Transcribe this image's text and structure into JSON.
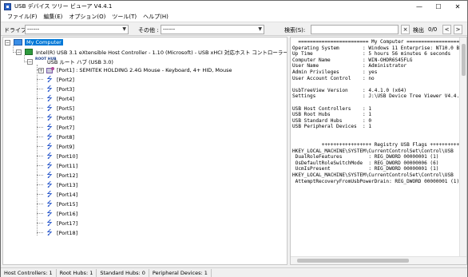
{
  "window": {
    "title": "USB デバイス ツリー ビューア V4.4.1",
    "minimize": "—",
    "maximize": "☐",
    "close": "✕"
  },
  "menu": [
    {
      "label": "ファイル(F)"
    },
    {
      "label": "編集(E)"
    },
    {
      "label": "オプション(O)"
    },
    {
      "label": "ツール(T)"
    },
    {
      "label": "ヘルプ(H)"
    }
  ],
  "toolbar": {
    "drive_label": "ドライブ:",
    "drive_value": "------",
    "other_label": "その他 :",
    "other_value": "------",
    "search_label": "検索(S):",
    "search_value": "",
    "clear_glyph": "×",
    "detect_label": "検出",
    "counter": "0/0",
    "prev_glyph": "<",
    "next_glyph": ">"
  },
  "tree": {
    "root": "My Computer",
    "controller": "Intel(R) USB 3.1 eXtensible Host Controller - 1.10 (Microsoft) - USB xHCI 対応ホスト コントローラー",
    "hub": "USB ルート ハブ (USB 3.0)",
    "hub_icon_text": "ROOT\nHUB",
    "device": "[Port1] : SEMITEK HOLDING 2.4G Mouse - Keyboard, 4+ HID, Mouse",
    "ports": [
      "[Port2]",
      "[Port3]",
      "[Port4]",
      "[Port5]",
      "[Port6]",
      "[Port7]",
      "[Port8]",
      "[Port9]",
      "[Port10]",
      "[Port11]",
      "[Port12]",
      "[Port13]",
      "[Port14]",
      "[Port15]",
      "[Port16]",
      "[Port17]",
      "[Port18]"
    ],
    "expanded_glyph": "−",
    "collapsed_glyph": "+",
    "usb_glyph": "⭍"
  },
  "info": {
    "text": "  ======================== My Computer =========================\nOperating System        : Windows 11 Enterprise: NT10.0 Bu\nUp Time                 : 5 hours 56 minutes 6 seconds\nComputer Name           : WIN-OHDR6S45FLG\nUser Name               : Administrator\nAdmin Privileges        : yes\nUser Account Control    : no\n\nUsbTreeView Version     : 4.4.1.0 (x64)\nSettings                : J:\\USB Device Tree Viewer V4.4.1\n\nUSB Host Controllers    : 1\nUSB Root Hubs           : 1\nUSB Standard Hubs       : 0\nUSB Peripheral Devices  : 1\n\n\n          +++++++++++++++++ Registry USB Flags ++++++++++++++++\nHKEY_LOCAL_MACHINE\\SYSTEM\\CurrentControlSet\\Control\\USB\n DualRoleFeatures         : REG_DWORD 00000001 (1)\n OsDefaultRoleSwitchMode  : REG_DWORD 00000006 (6)\n UcmIsPresent             : REG_DWORD 00000001 (1)\nHKEY_LOCAL_MACHINE\\SYSTEM\\CurrentControlSet\\Control\\USB\n AttemptRecoveryFromUsbPowerDrain: REG_DWORD 00000001 (1)"
  },
  "status": {
    "host_controllers": "Host Controllers: 1",
    "root_hubs": "Root Hubs: 1",
    "standard_hubs": "Standard Hubs: 0",
    "peripheral_devices": "Peripheral Devices: 1"
  }
}
